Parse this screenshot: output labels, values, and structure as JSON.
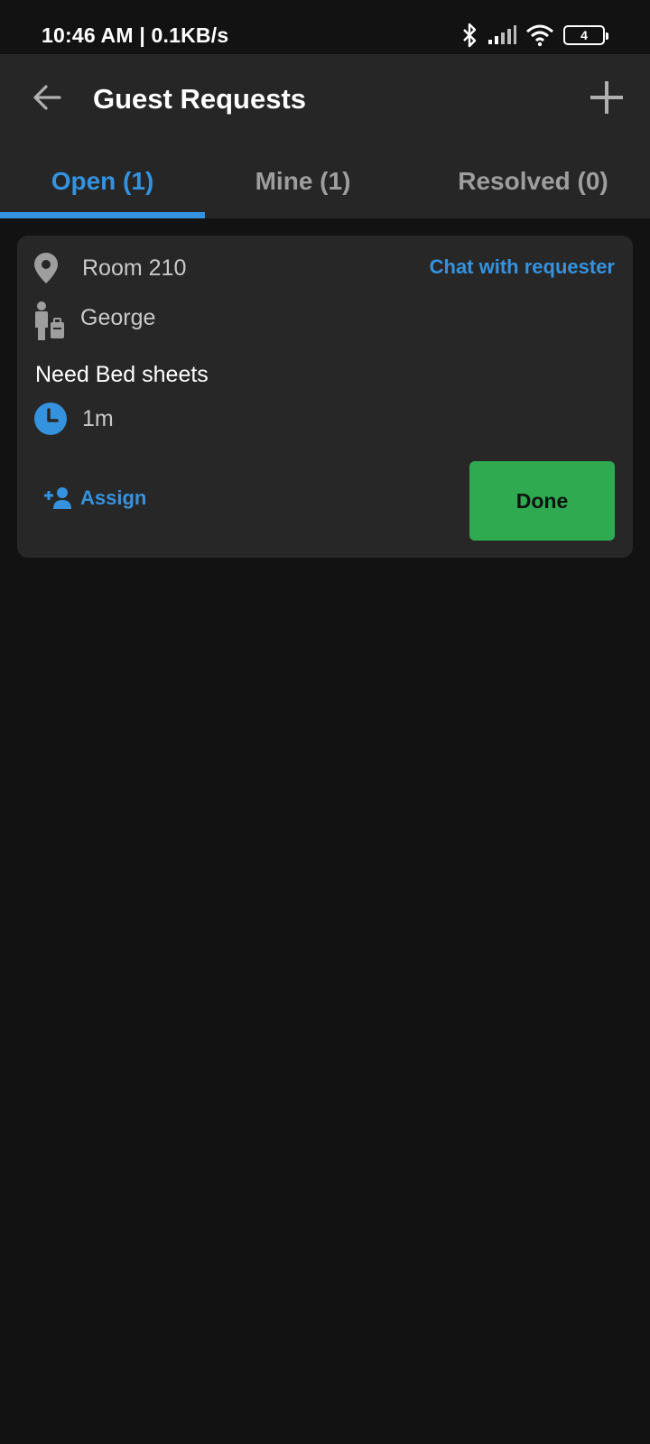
{
  "status_bar": {
    "time": "10:46 AM | 0.1KB/s",
    "battery": "4",
    "icons": [
      "bluetooth-icon",
      "signal-icon",
      "wifi-icon",
      "battery-icon"
    ]
  },
  "app_bar": {
    "title": "Guest Requests",
    "back_icon": "back-arrow-icon",
    "add_icon": "plus-icon"
  },
  "tabs": [
    {
      "label": "Open (1)",
      "active": true
    },
    {
      "label": "Mine (1)",
      "active": false
    },
    {
      "label": "Resolved (0)",
      "active": false
    }
  ],
  "requests": [
    {
      "room": "Room 210",
      "guest": "George",
      "description": "Need Bed sheets",
      "elapsed": "1m",
      "chat_label": "Chat with requester",
      "assign_label": "Assign",
      "done_label": "Done"
    }
  ],
  "colors": {
    "accent": "#3592de",
    "done_button": "#2faa50",
    "background": "#121212",
    "surface": "#262626"
  }
}
